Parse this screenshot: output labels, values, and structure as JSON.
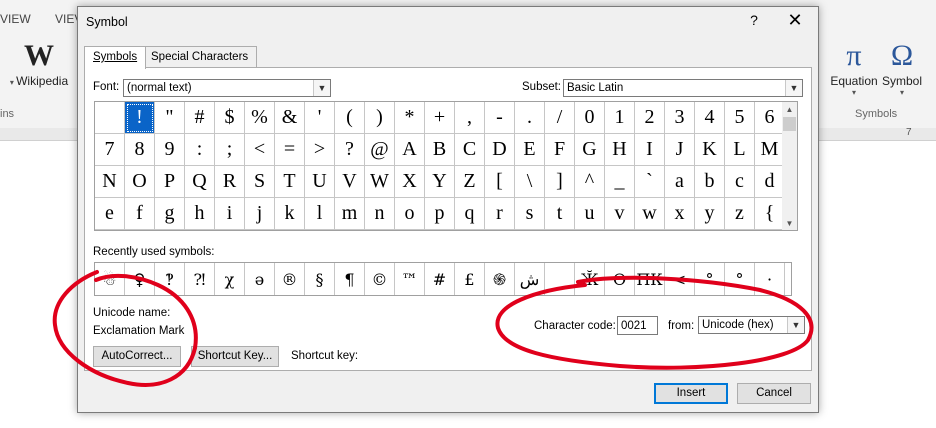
{
  "ribbon": {
    "tabs": [
      "VIEW",
      "VIEV"
    ],
    "wikipedia_label": "Wikipedia",
    "wikipedia_glyph": "W",
    "left_group_caption": "ins",
    "equation_label": "Equation",
    "equation_glyph": "π",
    "symbol_label": "Symbol",
    "symbol_glyph": "Ω",
    "symbols_group_caption": "Symbols",
    "ruler_number": "7"
  },
  "dialog": {
    "title": "Symbol",
    "help": "?",
    "close": "✕",
    "tabs": {
      "symbols": "Symbols",
      "special": "Special Characters"
    },
    "font_label": "Font:",
    "font_value": "(normal text)",
    "subset_label": "Subset:",
    "subset_value": "Basic Latin",
    "grid_rows": [
      [
        "",
        "!",
        "\"",
        "#",
        "$",
        "%",
        "&",
        "'",
        "(",
        ")",
        "*",
        "+",
        ",",
        "-",
        ".",
        "/",
        "0",
        "1",
        "2",
        "3",
        "4",
        "5",
        "6"
      ],
      [
        "7",
        "8",
        "9",
        ":",
        ";",
        "<",
        "=",
        ">",
        "?",
        "@",
        "A",
        "B",
        "C",
        "D",
        "E",
        "F",
        "G",
        "H",
        "I",
        "J",
        "K",
        "L",
        "M"
      ],
      [
        "N",
        "O",
        "P",
        "Q",
        "R",
        "S",
        "T",
        "U",
        "V",
        "W",
        "X",
        "Y",
        "Z",
        "[",
        "\\",
        "]",
        "^",
        "_",
        "`",
        "a",
        "b",
        "c",
        "d"
      ],
      [
        "e",
        "f",
        "g",
        "h",
        "i",
        "j",
        "k",
        "l",
        "m",
        "n",
        "o",
        "p",
        "q",
        "r",
        "s",
        "t",
        "u",
        "v",
        "w",
        "x",
        "y",
        "z",
        "{"
      ]
    ],
    "selected_index": 1,
    "recent_label": "Recently used symbols:",
    "recent_symbols": [
      "☃",
      "♀",
      "‽",
      "⁈",
      "χ",
      "ə",
      "®",
      "§",
      "¶",
      "©",
      "™",
      "#",
      "£",
      "֍",
      "ش",
      "",
      "Ӂ",
      "Ѳ",
      "ПК",
      "<",
      "°",
      "°",
      "·"
    ],
    "unicode_name_label": "Unicode name:",
    "unicode_name_value": "Exclamation Mark",
    "char_code_label": "Character code:",
    "char_code_value": "0021",
    "from_label": "from:",
    "from_value": "Unicode (hex)",
    "autocorrect_label": "AutoCorrect...",
    "shortcut_key_button": "Shortcut Key...",
    "shortcut_key_label": "Shortcut key:",
    "insert_label": "Insert",
    "cancel_label": "Cancel"
  },
  "colors": {
    "selection": "#0a64c8",
    "annotation": "#e0001b"
  }
}
